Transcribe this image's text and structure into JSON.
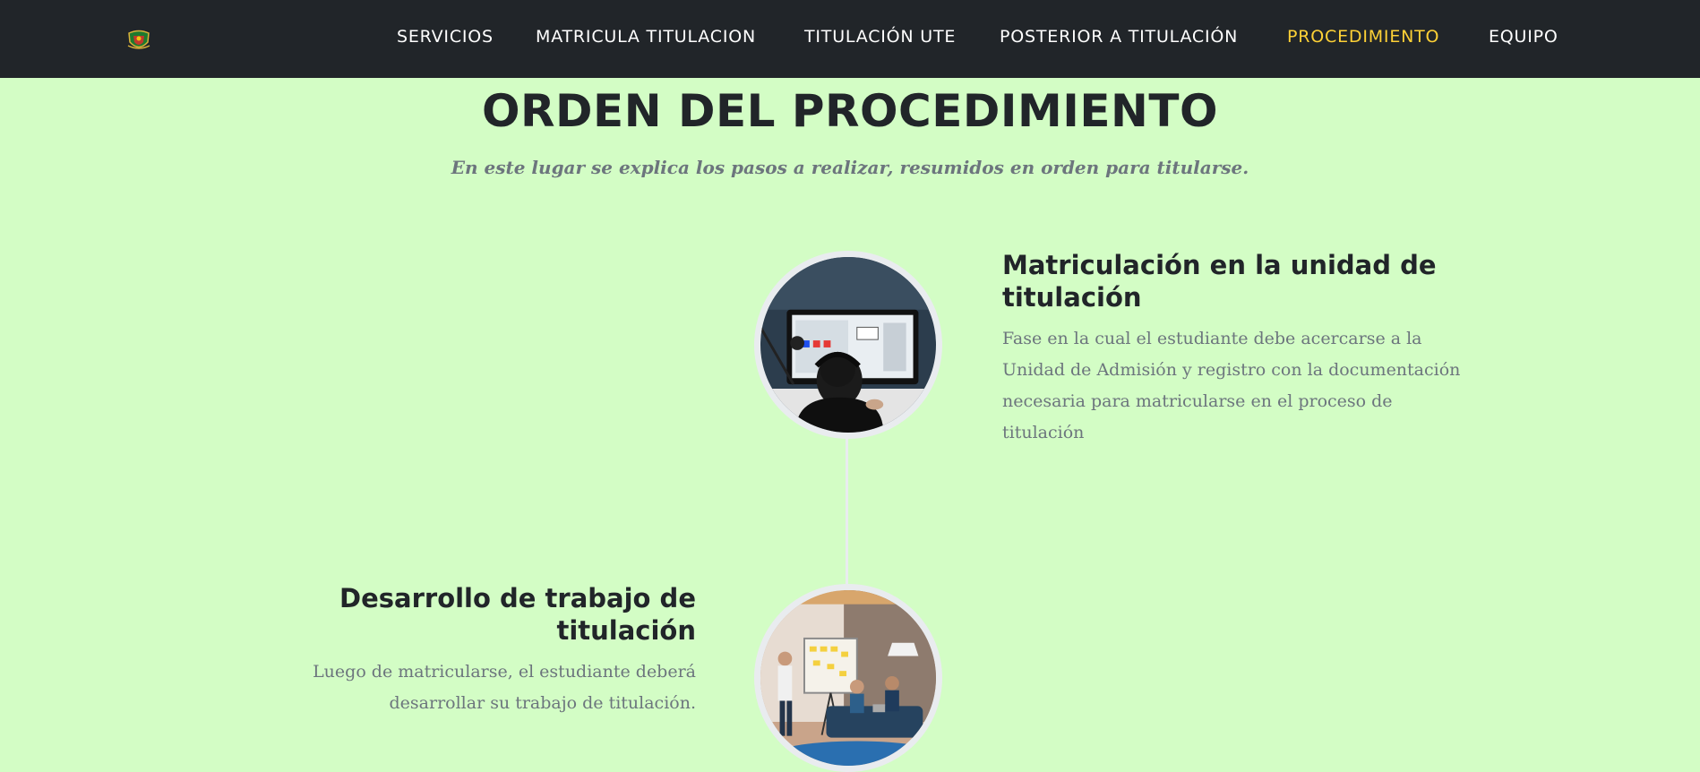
{
  "nav": {
    "logo_icon": "university-crest-icon",
    "links": [
      {
        "label": "SERVICIOS",
        "active": false
      },
      {
        "label": "MATRICULA TITULACION",
        "active": false
      },
      {
        "label": "TITULACIÓN UTE",
        "active": false
      },
      {
        "label": "POSTERIOR A TITULACIÓN",
        "active": false
      },
      {
        "label": "PROCEDIMIENTO",
        "active": true
      },
      {
        "label": "EQUIPO",
        "active": false
      }
    ],
    "colors": {
      "background": "#212529",
      "link": "#ffffff",
      "active": "#fed136"
    }
  },
  "section": {
    "heading": "ORDEN DEL PROCEDIMIENTO",
    "subheading": "En este lugar se explica los pasos a realizar, resumidos en orden para titularse.",
    "background": "#d3fdc5"
  },
  "timeline": [
    {
      "title": "Matriculación en la unidad de titulación",
      "body": "Fase en la cual el estudiante debe acercarse a la Unidad de Admisión y registro con la documentación necesaria para matricularse en el proceso de titulación",
      "image": "person-with-headphones-at-computer"
    },
    {
      "title": "Desarrollo de trabajo de titulación",
      "body": "Luego de matricularse, el estudiante deberá desarrollar su trabajo de titulación.",
      "image": "team-meeting-whiteboard"
    }
  ]
}
